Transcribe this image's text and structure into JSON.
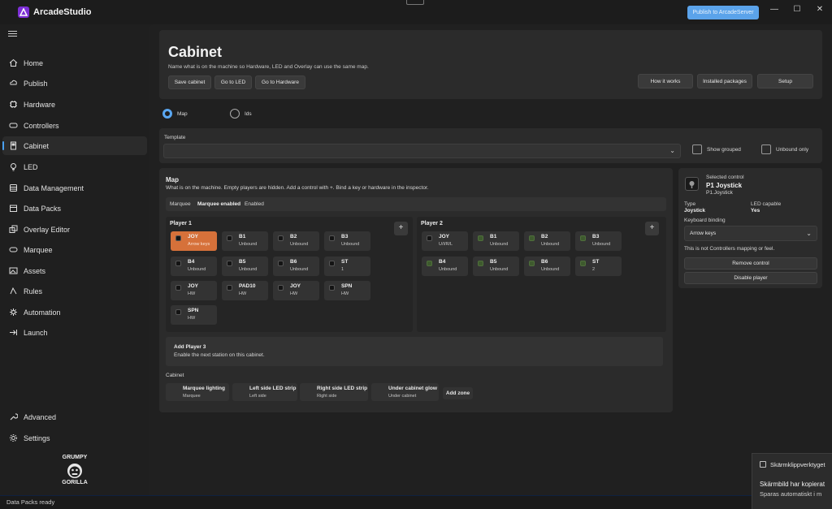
{
  "app": {
    "name": "ArcadeStudio",
    "publish_label": "Publish to ArcadeServer"
  },
  "window_controls": {
    "minimize": "—",
    "maximize": "☐",
    "close": "✕"
  },
  "nav": [
    {
      "label": "Home",
      "icon": "home-icon"
    },
    {
      "label": "Publish",
      "icon": "publish-icon"
    },
    {
      "label": "Hardware",
      "icon": "chip-icon"
    },
    {
      "label": "Controllers",
      "icon": "gamepad-icon"
    },
    {
      "label": "Cabinet",
      "icon": "cabinet-icon",
      "active": true
    },
    {
      "label": "LED",
      "icon": "bulb-icon"
    },
    {
      "label": "Data Management",
      "icon": "database-icon"
    },
    {
      "label": "Data Packs",
      "icon": "package-icon"
    },
    {
      "label": "Overlay Editor",
      "icon": "layers-icon"
    },
    {
      "label": "Marquee",
      "icon": "marquee-icon"
    },
    {
      "label": "Assets",
      "icon": "image-icon"
    },
    {
      "label": "Rules",
      "icon": "rules-icon"
    },
    {
      "label": "Automation",
      "icon": "automation-icon"
    },
    {
      "label": "Launch",
      "icon": "launch-icon"
    }
  ],
  "nav_bottom": [
    {
      "label": "Advanced",
      "icon": "wrench-icon"
    },
    {
      "label": "Settings",
      "icon": "gear-icon"
    }
  ],
  "status": "Data Packs ready",
  "header": {
    "title": "Cabinet",
    "subtitle": "Name what is on the machine so Hardware, LED and Overlay can use the same map.",
    "buttons": [
      "Save cabinet",
      "Go to LED",
      "Go to Hardware"
    ],
    "right_buttons": [
      "How it works",
      "Installed packages",
      "Setup"
    ]
  },
  "mode": {
    "options": [
      "Map",
      "Ids"
    ],
    "selected": "Map"
  },
  "template": {
    "label": "Template",
    "value": "",
    "show_grouped": "Show grouped",
    "unbound_only": "Unbound only"
  },
  "map": {
    "title": "Map",
    "description": "What is on the machine. Empty players are hidden. Add a control with +. Bind a key or hardware in the inspector.",
    "tabs": [
      "Marquee",
      "Marquee enabled",
      "Enabled"
    ]
  },
  "player1": {
    "title": "Player 1",
    "add": "+",
    "controls": [
      {
        "name": "JOY",
        "status": "Arrow keys",
        "highlight": true
      },
      {
        "name": "B1",
        "status": "Unbound"
      },
      {
        "name": "B2",
        "status": "Unbound"
      },
      {
        "name": "B3",
        "status": "Unbound"
      },
      {
        "name": "B4",
        "status": "Unbound"
      },
      {
        "name": "B5",
        "status": "Unbound"
      },
      {
        "name": "B6",
        "status": "Unbound"
      },
      {
        "name": "ST",
        "status": "1"
      },
      {
        "name": "JOY",
        "status": "HW"
      },
      {
        "name": "PAD10",
        "status": "HW"
      },
      {
        "name": "JOY",
        "status": "HW"
      },
      {
        "name": "SPN",
        "status": "HW"
      },
      {
        "name": "SPN",
        "status": "HW"
      }
    ]
  },
  "player2": {
    "title": "Player 2",
    "add": "+",
    "controls": [
      {
        "name": "JOY",
        "status": "U/I/R/L"
      },
      {
        "name": "B1",
        "status": "Unbound"
      },
      {
        "name": "B2",
        "status": "Unbound"
      },
      {
        "name": "B3",
        "status": "Unbound"
      },
      {
        "name": "B4",
        "status": "Unbound"
      },
      {
        "name": "B5",
        "status": "Unbound"
      },
      {
        "name": "B6",
        "status": "Unbound"
      },
      {
        "name": "ST",
        "status": "2"
      }
    ]
  },
  "add_player": {
    "title": "Add Player 3",
    "subtitle": "Enable the next station on this cabinet."
  },
  "cabinet": {
    "title": "Cabinet",
    "zones": [
      {
        "name": "Marquee lighting",
        "sub": "Marquee"
      },
      {
        "name": "Left side LED strip",
        "sub": "Left side"
      },
      {
        "name": "Right side LED strip",
        "sub": "Right side"
      },
      {
        "name": "Under cabinet glow",
        "sub": "Under cabinet"
      }
    ],
    "add_zone": "Add zone"
  },
  "inspector": {
    "caption": "Selected control",
    "name": "P1 Joystick",
    "id": "P1.Joystick",
    "type_label": "Type",
    "type_value": "Joystick",
    "led_label": "LED capable",
    "led_value": "Yes",
    "kb_label": "Keyboard binding",
    "kb_value": "Arrow keys",
    "note": "This is not Controllers mapping or feel.",
    "remove": "Remove control",
    "disable": "Disable player"
  },
  "toast": {
    "app": "Skärmklippverktyget",
    "title": "Skärmbild har kopierat",
    "body": "Sparas automatiskt i m"
  },
  "brand": {
    "line1": "GRUMPY",
    "line2": "GORILLA"
  },
  "colors": {
    "accent": "#5aa7f2",
    "highlight": "#d6713a",
    "logo": "#7d2fd6"
  }
}
